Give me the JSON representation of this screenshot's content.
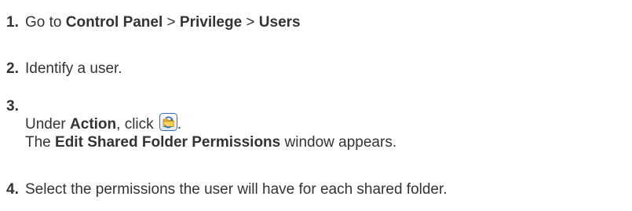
{
  "steps": [
    {
      "number": "1.",
      "prefix": "Go to ",
      "control_panel": "Control Panel",
      "sep1": " > ",
      "privilege": "Privilege",
      "sep2": " > ",
      "users": "Users"
    },
    {
      "number": "2.",
      "text": "Identify a user."
    },
    {
      "number": "3.",
      "under": "Under ",
      "action": "Action",
      "click": ", click ",
      "period": ".",
      "icon": "edit-shared-folder-permissions-icon",
      "line2_prefix": "The ",
      "window_name": "Edit Shared Folder Permissions",
      "line2_suffix": " window appears."
    },
    {
      "number": "4.",
      "text": "Select the permissions the user will have for each shared folder."
    }
  ],
  "colors": {
    "text": "#333333",
    "icon_border": "#2e6db4",
    "icon_fill": "#f2b632"
  }
}
